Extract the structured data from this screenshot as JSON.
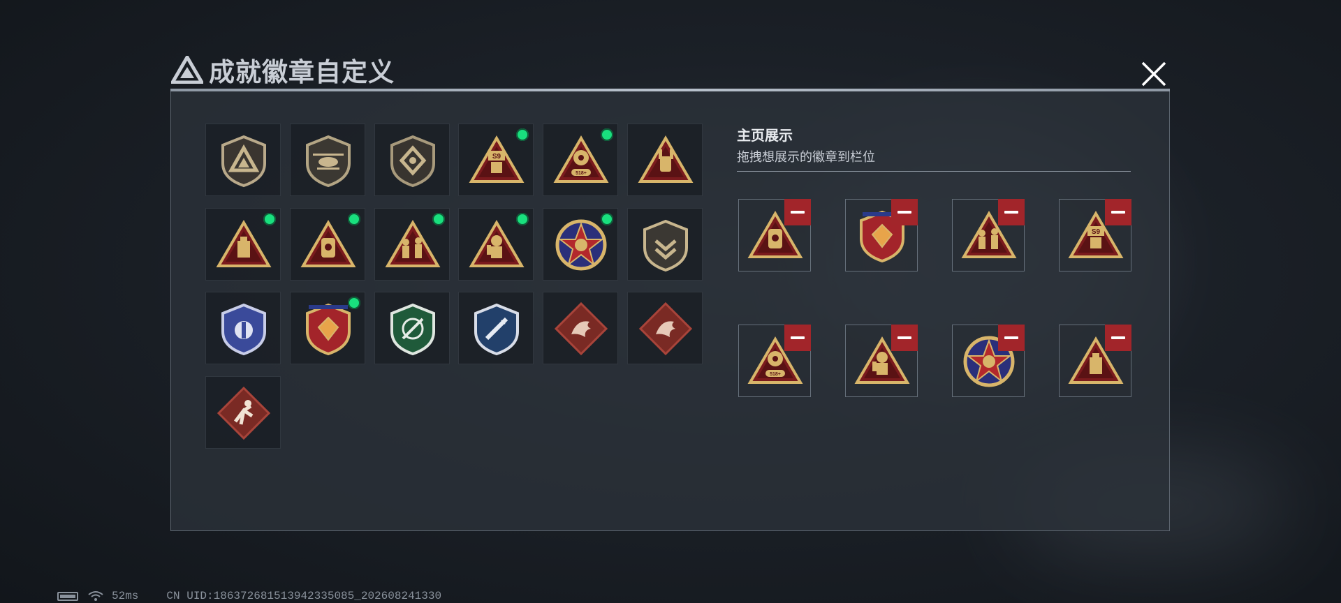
{
  "header": {
    "title": "成就徽章自定义"
  },
  "colors": {
    "accent_green": "#19e07e",
    "remove_red": "#a2252a",
    "gold": "#d8b56a",
    "badge_red": "#7a1a1d"
  },
  "badges": [
    {
      "icon": "faction-a-shield-badge-icon",
      "is_new": false
    },
    {
      "icon": "helicopter-shield-badge-icon",
      "is_new": false
    },
    {
      "icon": "diamond-emblem-shield-badge-icon",
      "is_new": false
    },
    {
      "icon": "s9-robot-triangle-badge-icon",
      "is_new": true
    },
    {
      "icon": "518-gear-triangle-badge-icon",
      "is_new": true
    },
    {
      "icon": "rock-hand-triangle-badge-icon",
      "is_new": false
    },
    {
      "icon": "drive-triangle-badge-icon",
      "is_new": true
    },
    {
      "icon": "skull-jar-triangle-badge-icon",
      "is_new": true
    },
    {
      "icon": "soldiers-triangle-badge-icon",
      "is_new": true
    },
    {
      "icon": "diver-triangle-badge-icon",
      "is_new": true
    },
    {
      "icon": "star-medal-badge-icon",
      "is_new": true
    },
    {
      "icon": "chevron-shield-badge-icon",
      "is_new": false
    },
    {
      "icon": "blue-wing-shield-badge-icon",
      "is_new": false
    },
    {
      "icon": "red-gem-shield-badge-icon",
      "is_new": true
    },
    {
      "icon": "green-crosshair-shield-badge-icon",
      "is_new": false
    },
    {
      "icon": "blue-rocket-shield-badge-icon",
      "is_new": false
    },
    {
      "icon": "dragon-diamond-badge-icon",
      "is_new": false
    },
    {
      "icon": "dragon-diamond-badge-icon",
      "is_new": false
    },
    {
      "icon": "runner-diamond-badge-icon",
      "is_new": false
    }
  ],
  "showcase": {
    "title": "主页展示",
    "subtitle": "拖拽想展示的徽章到栏位",
    "slots": [
      {
        "icon": "skull-jar-triangle-badge-icon"
      },
      {
        "icon": "red-gem-shield-badge-icon"
      },
      {
        "icon": "soldiers-triangle-badge-icon"
      },
      {
        "icon": "s9-robot-triangle-badge-icon"
      },
      {
        "icon": "518-gear-triangle-badge-icon"
      },
      {
        "icon": "diver-triangle-badge-icon"
      },
      {
        "icon": "star-medal-badge-icon"
      },
      {
        "icon": "drive-triangle-badge-icon"
      }
    ]
  },
  "status": {
    "ping": "52ms",
    "uid": "CN UID:18637268151394233508​5_202608241330"
  }
}
